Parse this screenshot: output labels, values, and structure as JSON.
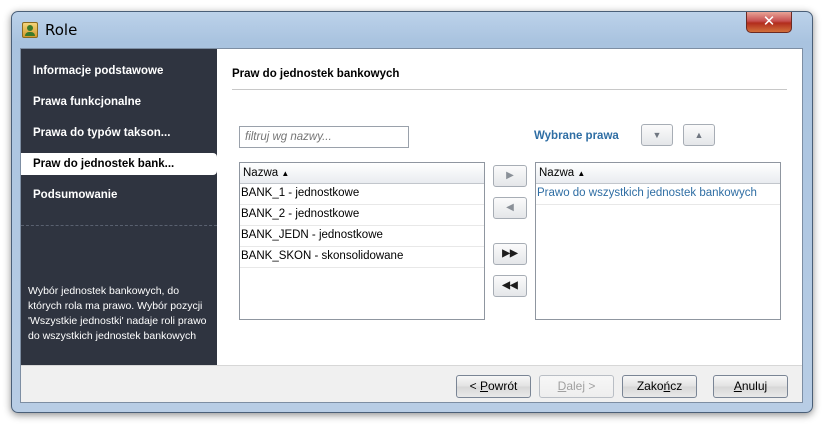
{
  "window": {
    "title": "Role",
    "close_label": "✕"
  },
  "sidebar": {
    "items": [
      {
        "label": "Informacje podstawowe",
        "active": false
      },
      {
        "label": "Prawa funkcjonalne",
        "active": false
      },
      {
        "label": "Prawa do typów takson...",
        "active": false
      },
      {
        "label": "Praw do jednostek bank...",
        "active": true
      },
      {
        "label": "Podsumowanie",
        "active": false
      }
    ],
    "help_text": "Wybór jednostek bankowych, do których rola ma prawo. Wybór pozycji 'Wszystkie jednostki' nadaje roli prawo do wszystkich jednostek bankowych"
  },
  "main": {
    "title": "Praw do jednostek bankowych",
    "filter_placeholder": "filtruj wg nazwy...",
    "selected_label": "Wybrane prawa",
    "available": {
      "column": "Nazwa",
      "rows": [
        "BANK_1 - jednostkowe",
        "BANK_2 - jednostkowe",
        "BANK_JEDN - jednostkowe",
        "BANK_SKON - skonsolidowane"
      ]
    },
    "selected": {
      "column": "Nazwa",
      "rows": [
        "Prawo do wszystkich jednostek bankowych"
      ]
    },
    "transfer_buttons": {
      "add_one": "▶",
      "remove_one": "◀",
      "add_all": "▶▶",
      "remove_all": "◀◀"
    },
    "order_buttons": {
      "down": "▼",
      "up": "▲"
    },
    "sort_indicator": "▲"
  },
  "footer": {
    "back": {
      "prefix": "< ",
      "mnemonic": "P",
      "rest": "owrót"
    },
    "next": {
      "mnemonic": "D",
      "rest": "alej >"
    },
    "finish": {
      "prefix": "Zako",
      "mnemonic": "ń",
      "rest": "cz"
    },
    "cancel": {
      "mnemonic": "A",
      "rest": "nuluj"
    }
  },
  "colors": {
    "sidebar_bg": "#2f3440",
    "accent_blue": "#2f6ea4"
  }
}
